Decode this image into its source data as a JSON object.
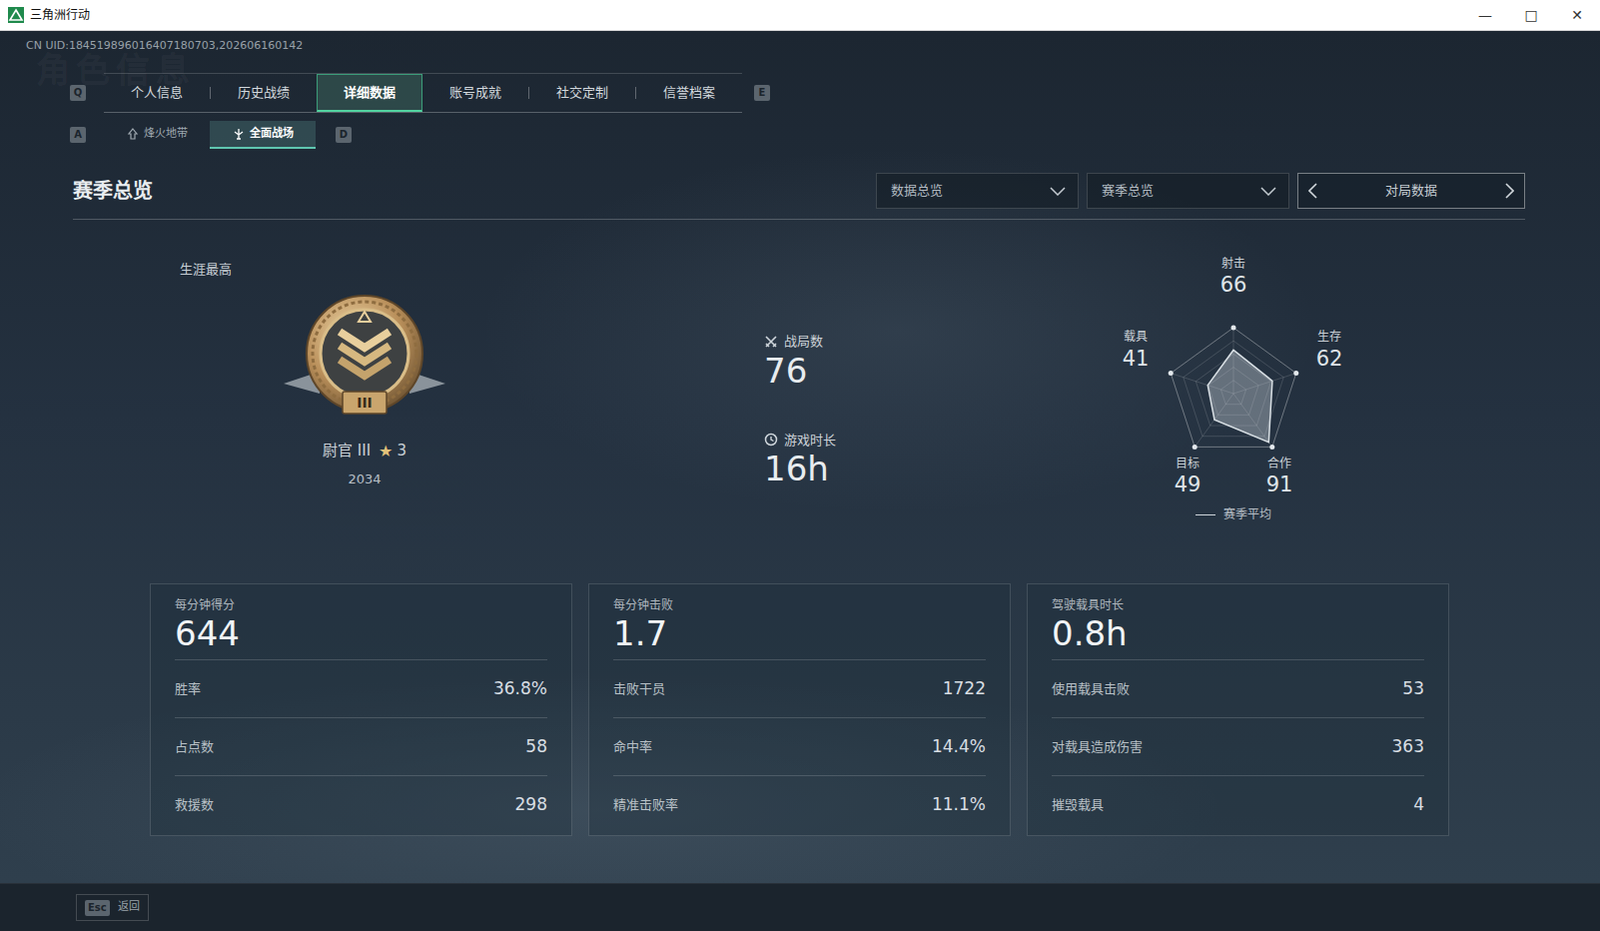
{
  "window": {
    "title": "三角洲行动",
    "controls": [
      "—",
      "□",
      "✕"
    ]
  },
  "uid": "CN UID:184519896016407180703,202606160142",
  "watermark": "角色信息",
  "tabs": {
    "prev_key": "Q",
    "next_key": "E",
    "items": [
      {
        "label": "个人信息",
        "selected": false
      },
      {
        "label": "历史战绩",
        "selected": false
      },
      {
        "label": "详细数据",
        "selected": true
      },
      {
        "label": "账号成就",
        "selected": false
      },
      {
        "label": "社交定制",
        "selected": false
      },
      {
        "label": "信誉档案",
        "selected": false
      }
    ]
  },
  "subtabs": {
    "prev_key": "A",
    "next_key": "D",
    "items": [
      {
        "label": "烽火地带",
        "selected": false
      },
      {
        "label": "全面战场",
        "selected": true
      }
    ]
  },
  "section": {
    "title": "赛季总览",
    "filters": [
      "数据总览",
      "赛季总览"
    ],
    "pager": "对局数据"
  },
  "rank": {
    "caption": "生涯最高",
    "numeral": "III",
    "title": "尉官 III",
    "star": "★",
    "stars_count": "3",
    "score": "2034"
  },
  "summary": [
    {
      "label": "战局数",
      "value": "76",
      "kind": "matches"
    },
    {
      "label": "游戏时长",
      "value": "16h",
      "kind": "time"
    }
  ],
  "radar": {
    "axes": [
      {
        "label": "射击",
        "value": "66"
      },
      {
        "label": "生存",
        "value": "62"
      },
      {
        "label": "合作",
        "value": "91"
      },
      {
        "label": "目标",
        "value": "49"
      },
      {
        "label": "载具",
        "value": "41"
      }
    ],
    "series": [
      {
        "name": "赛季平均",
        "values": [
          66,
          62,
          91,
          49,
          41
        ]
      }
    ]
  },
  "cards": [
    {
      "label": "每分钟得分",
      "value": "644",
      "rows": [
        {
          "label": "胜率",
          "value": "36.8%"
        },
        {
          "label": "占点数",
          "value": "58"
        },
        {
          "label": "救援数",
          "value": "298"
        }
      ]
    },
    {
      "label": "每分钟击败",
      "value": "1.7",
      "rows": [
        {
          "label": "击败干员",
          "value": "1722"
        },
        {
          "label": "命中率",
          "value": "14.4%"
        },
        {
          "label": "精准击败率",
          "value": "11.1%"
        }
      ]
    },
    {
      "label": "驾驶载具时长",
      "value": "0.8h",
      "rows": [
        {
          "label": "使用载具击败",
          "value": "53"
        },
        {
          "label": "对载具造成伤害",
          "value": "363"
        },
        {
          "label": "摧毁载具",
          "value": "4"
        }
      ]
    }
  ],
  "footer": {
    "key": "Esc",
    "label": "返回"
  }
}
